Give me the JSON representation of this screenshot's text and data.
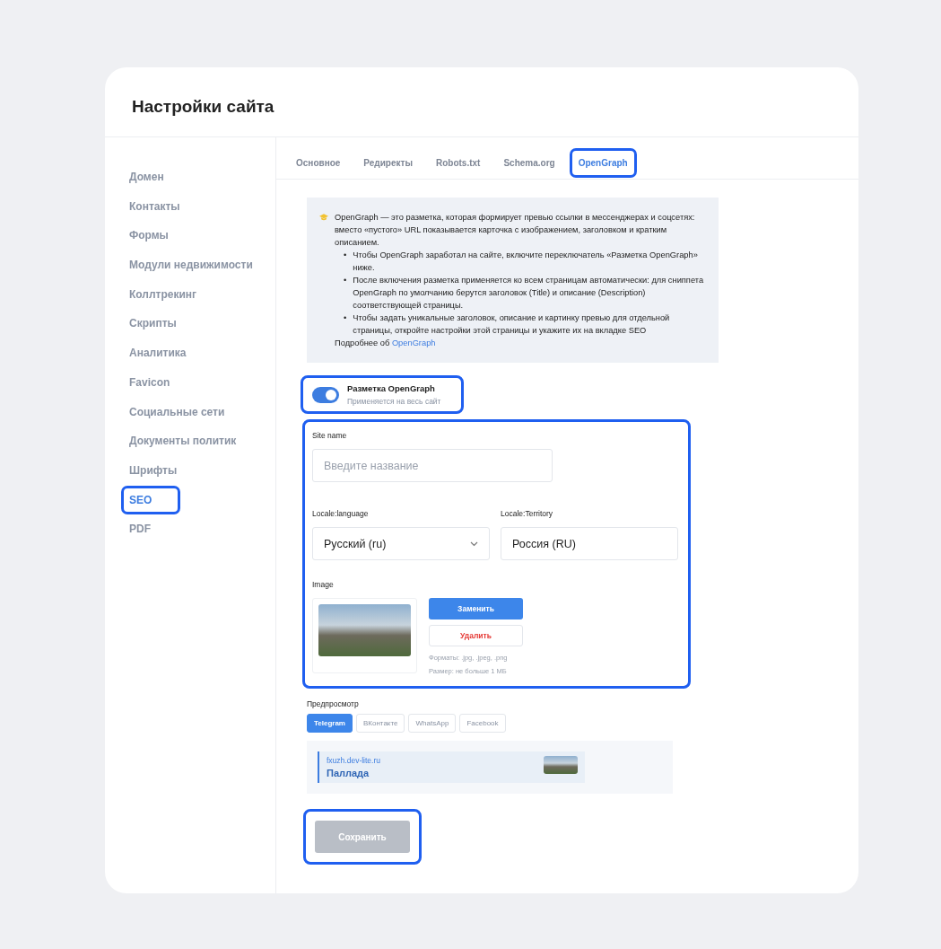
{
  "title": "Настройки сайта",
  "sidebar": {
    "items": [
      {
        "label": "Домен",
        "selected": false,
        "highlighted": false
      },
      {
        "label": "Контакты",
        "selected": false,
        "highlighted": false
      },
      {
        "label": "Формы",
        "selected": false,
        "highlighted": false
      },
      {
        "label": "Модули недвижимости",
        "selected": false,
        "highlighted": false
      },
      {
        "label": "Коллтрекинг",
        "selected": false,
        "highlighted": false
      },
      {
        "label": "Скрипты",
        "selected": false,
        "highlighted": false
      },
      {
        "label": "Аналитика",
        "selected": false,
        "highlighted": false
      },
      {
        "label": "Favicon",
        "selected": false,
        "highlighted": false
      },
      {
        "label": "Социальные сети",
        "selected": false,
        "highlighted": false
      },
      {
        "label": "Документы политик",
        "selected": false,
        "highlighted": false
      },
      {
        "label": "Шрифты",
        "selected": false,
        "highlighted": false
      },
      {
        "label": "SEO",
        "selected": true,
        "highlighted": true
      },
      {
        "label": "PDF",
        "selected": false,
        "highlighted": false
      }
    ]
  },
  "tabs": [
    {
      "label": "Основное",
      "selected": false,
      "highlighted": false
    },
    {
      "label": "Редиректы",
      "selected": false,
      "highlighted": false
    },
    {
      "label": "Robots.txt",
      "selected": false,
      "highlighted": false
    },
    {
      "label": "Schema.org",
      "selected": false,
      "highlighted": false
    },
    {
      "label": "OpenGraph",
      "selected": true,
      "highlighted": true
    }
  ],
  "info": {
    "intro": "OpenGraph — это разметка, которая формирует превью ссылки в мессенджерах и соцсетях: вместо «пустого» URL показывается карточка с изображением, заголовком и кратким описанием.",
    "bullets": [
      {
        "marker": "•",
        "text": "Чтобы OpenGraph заработал на сайте, включите переключатель «Разметка OpenGraph» ниже."
      },
      {
        "marker": "•",
        "text": "После включения разметка применяется ко всем страницам автоматически: для сниппета OpenGraph по умолчанию берутся заголовок (Title) и описание (Description) соответствующей страницы."
      },
      {
        "marker": "•",
        "text": "Чтобы задать уникальные заголовок, описание и картинку превью для отдельной страницы, откройте настройки этой страницы и укажите их на вкладке SEO"
      }
    ],
    "more_prefix": "Подробнее об",
    "more_link": "OpenGraph"
  },
  "toggle": {
    "label": "Разметка OpenGraph",
    "hint": "Применяется на весь сайт",
    "on": true,
    "highlighted": true
  },
  "form": {
    "highlighted": true,
    "site_name": {
      "label": "Site name",
      "placeholder": "Введите название"
    },
    "language": {
      "label": "Locale:language",
      "value": "Русский (ru)"
    },
    "territory": {
      "label": "Locale:Territory",
      "value": "Россия (RU)"
    },
    "image": {
      "label": "Image",
      "replace": "Заменить",
      "delete": "Удалить",
      "formats": "Форматы: .jpg, .jpeg, .png",
      "size": "Размер: не больше 1 МБ"
    }
  },
  "preview": {
    "label": "Предпросмотр",
    "tabs": [
      {
        "label": "Telegram",
        "selected": true
      },
      {
        "label": "ВКонтакте",
        "selected": false
      },
      {
        "label": "WhatsApp",
        "selected": false
      },
      {
        "label": "Facebook",
        "selected": false
      }
    ],
    "card": {
      "domain": "fxuzh.dev-lite.ru",
      "title": "Паллада"
    }
  },
  "save": {
    "label": "Сохранить",
    "disabled": true,
    "highlighted": true
  }
}
